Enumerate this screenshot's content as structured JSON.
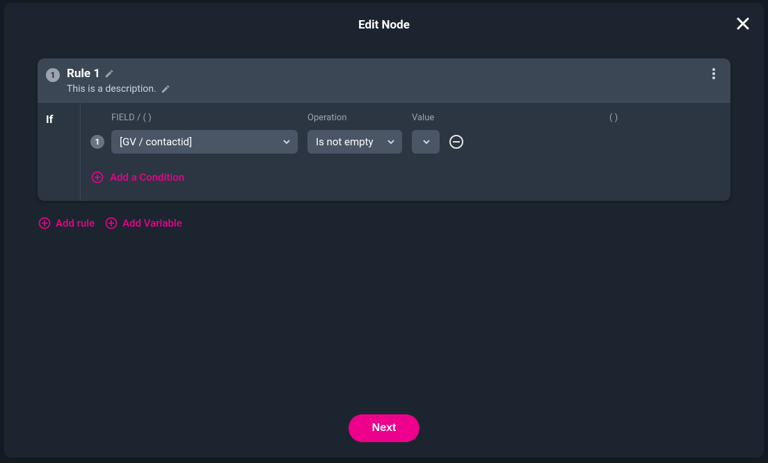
{
  "modal": {
    "title": "Edit Node",
    "next_label": "Next"
  },
  "rule": {
    "badge": "1",
    "title": "Rule 1",
    "description": "This is a description.",
    "if_label": "If",
    "headers": {
      "field": "FIELD / ( )",
      "operation": "Operation",
      "value": "Value",
      "paren": "( )"
    },
    "condition": {
      "index": "1",
      "field": "[GV / contactid]",
      "operation": "Is not empty",
      "value": ""
    },
    "add_condition_label": "Add a Condition"
  },
  "actions": {
    "add_rule": "Add rule",
    "add_variable": "Add Variable"
  }
}
